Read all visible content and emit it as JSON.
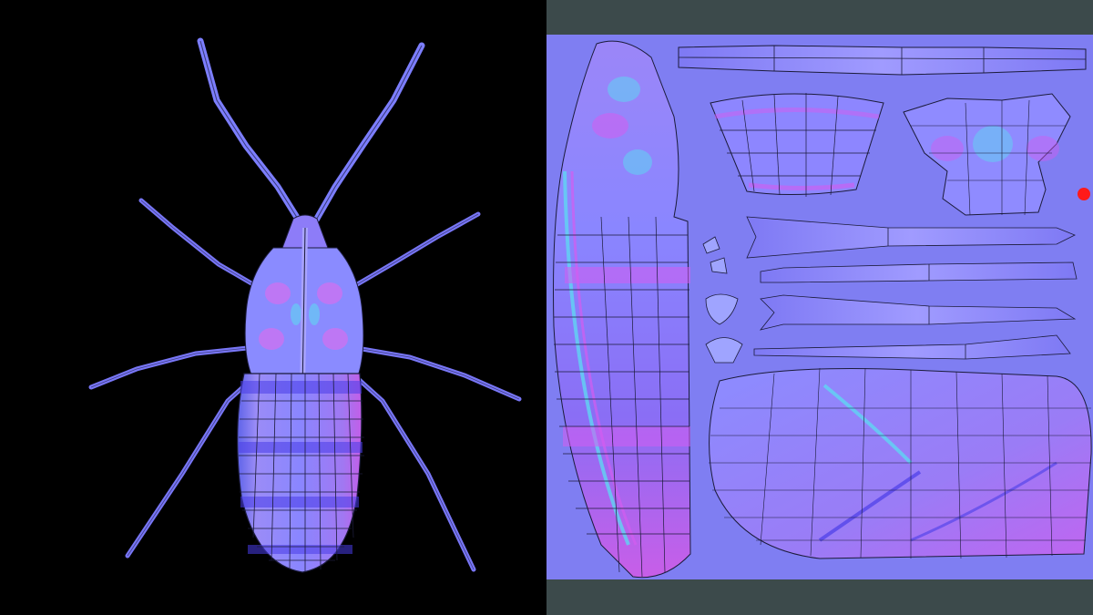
{
  "viewport": {
    "name": "3D viewport",
    "object": "insect-model",
    "background": "#000000"
  },
  "uv_editor": {
    "background": "#7f7ef2",
    "frame_color": "#3c4a4b",
    "marker_color": "#ff1a1a"
  },
  "colors": {
    "normal_base": "#8080ff",
    "magenta": "#d35cf0",
    "cyan": "#5fd6f2",
    "blue": "#5b4df0",
    "wire": "#1b1b3a"
  }
}
